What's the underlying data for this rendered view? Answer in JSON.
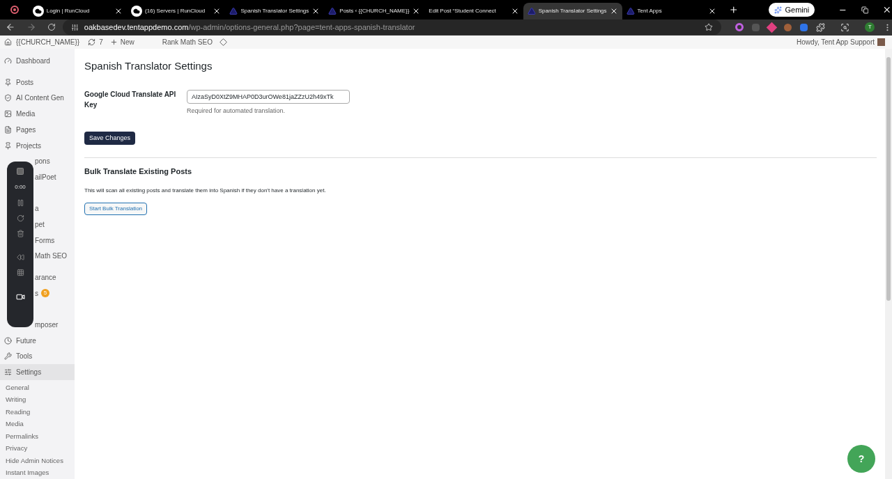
{
  "browser": {
    "tabs": [
      {
        "title": "Login | RunCloud",
        "selected": false
      },
      {
        "title": "(16) Servers | RunCloud",
        "selected": false
      },
      {
        "title": "Spanish Translator Settings",
        "selected": false
      },
      {
        "title": "Posts ‹ {{CHURCH_NAME}}",
        "selected": false
      },
      {
        "title": "Edit Post “Student Connect",
        "selected": false
      },
      {
        "title": "Spanish Translator Settings",
        "selected": true
      },
      {
        "title": "Tent Apps",
        "selected": false
      }
    ],
    "gemini": "Gemini",
    "url_host": "oakbasedev.tentappdemo.com",
    "url_path": "/wp-admin/options-general.php?page=tent-apps-spanish-translator",
    "profile": "T"
  },
  "admin_bar": {
    "site": "{{CHURCH_NAME}}",
    "updates": "7",
    "new": "New",
    "seo": "Rank Math SEO",
    "howdy": "Howdy, Tent App Support"
  },
  "sidebar": {
    "items": [
      {
        "kind": "item",
        "label": "Dashboard",
        "selected": false
      },
      {
        "kind": "separator"
      },
      {
        "kind": "item",
        "label": "Posts",
        "selected": false
      },
      {
        "kind": "item",
        "label": "AI Content Gen",
        "selected": false
      },
      {
        "kind": "item",
        "label": "Media",
        "selected": false
      },
      {
        "kind": "item",
        "label": "Pages",
        "selected": false
      },
      {
        "kind": "item",
        "label": "Projects",
        "selected": false
      },
      {
        "kind": "covered",
        "label": "pons"
      },
      {
        "kind": "covered",
        "label": "ailPoet"
      },
      {
        "kind": "covered"
      },
      {
        "kind": "covered",
        "label": "a"
      },
      {
        "kind": "covered",
        "label": "pet"
      },
      {
        "kind": "covered",
        "label": "Forms"
      },
      {
        "kind": "covered",
        "label": "Math SEO"
      },
      {
        "kind": "separator"
      },
      {
        "kind": "covered",
        "label": "arance"
      },
      {
        "kind": "covered",
        "label": "s",
        "badge": "5"
      },
      {
        "kind": "covered"
      },
      {
        "kind": "covered",
        "label": "mposer"
      },
      {
        "kind": "item",
        "label": "Future",
        "selected": false
      },
      {
        "kind": "item",
        "label": "Tools",
        "selected": false
      },
      {
        "kind": "item",
        "label": "Settings",
        "selected": true
      }
    ],
    "submenu": [
      "General",
      "Writing",
      "Reading",
      "Media",
      "Permalinks",
      "Privacy",
      "Hide Admin Notices",
      "Instant Images"
    ]
  },
  "recorder": {
    "time": "0:00"
  },
  "page": {
    "title": "Spanish Translator Settings",
    "field_label": "Google Cloud Translate API Key",
    "field_value": "AIzaSyD0XtZ9MHAP0D3urOWe81jaZZzU2h49xTk",
    "field_hint": "Required for automated translation.",
    "save": "Save Changes",
    "bulk_title": "Bulk Translate Existing Posts",
    "bulk_text": "This will scan all existing posts and translate them into Spanish if they don't have a translation yet.",
    "bulk_button": "Start Bulk Translation"
  },
  "help_button": "?"
}
